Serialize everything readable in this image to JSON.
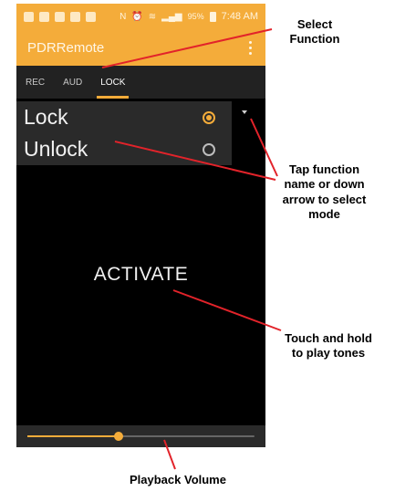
{
  "colors": {
    "accent": "#f4ac3a",
    "screen_bg": "#000000",
    "panel_bg": "#2a2a2a",
    "callout_line": "#e2232a"
  },
  "status_bar": {
    "time": "7:48 AM",
    "battery_text": "95%"
  },
  "app_bar": {
    "title": "PDRRemote",
    "overflow_icon": "overflow-menu-icon"
  },
  "tabs": [
    {
      "label": "REC",
      "active": false
    },
    {
      "label": "AUD",
      "active": false
    },
    {
      "label": "LOCK",
      "active": true
    }
  ],
  "modes": [
    {
      "label": "Lock",
      "selected": true
    },
    {
      "label": "Unlock",
      "selected": false
    }
  ],
  "dropdown_icon": "dropdown-arrow-icon",
  "activate": {
    "label": "ACTIVATE"
  },
  "volume": {
    "level": 0.4
  },
  "callouts": {
    "select_function": [
      "Select",
      "Function"
    ],
    "tap_function": [
      "Tap function",
      "name or down",
      "arrow to select",
      "mode"
    ],
    "touch_hold": [
      "Touch and hold",
      "to play tones"
    ],
    "playback_volume": "Playback Volume"
  }
}
